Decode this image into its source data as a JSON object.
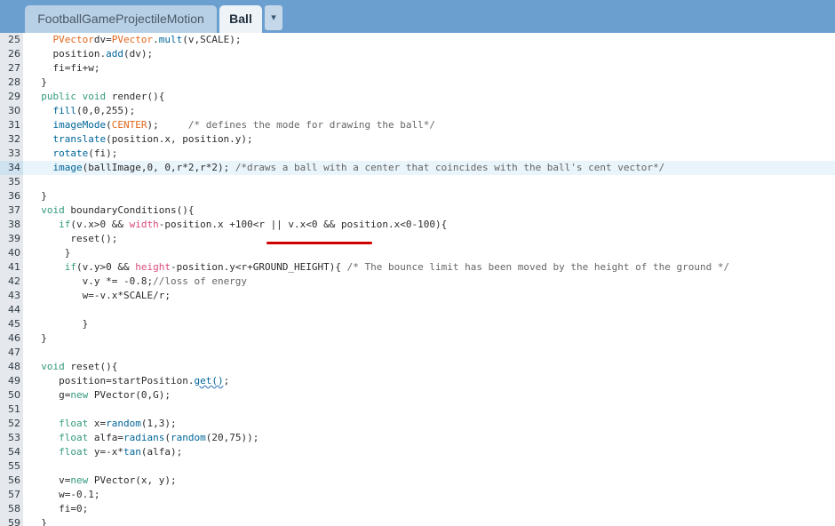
{
  "tabs": [
    {
      "label": "FootballGameProjectileMotion",
      "active": false
    },
    {
      "label": "Ball",
      "active": true
    }
  ],
  "tab_menu_icon": "▾",
  "highlighted_line": "34",
  "lines": [
    {
      "num": "25",
      "indent": "    ",
      "tokens": [
        [
          "t-type",
          "PVector"
        ],
        [
          "",
          "dv="
        ],
        [
          "t-type",
          "PVector"
        ],
        [
          "",
          "."
        ],
        [
          "t-fn",
          "mult"
        ],
        [
          "",
          "(v,SCALE);"
        ]
      ]
    },
    {
      "num": "26",
      "indent": "    ",
      "tokens": [
        [
          "",
          "position."
        ],
        [
          "t-fn",
          "add"
        ],
        [
          "",
          "(dv);"
        ]
      ]
    },
    {
      "num": "27",
      "indent": "    ",
      "tokens": [
        [
          "",
          "fi=fi+w;"
        ]
      ]
    },
    {
      "num": "28",
      "indent": "  ",
      "tokens": [
        [
          "",
          "}"
        ]
      ]
    },
    {
      "num": "29",
      "indent": "  ",
      "tokens": [
        [
          "t-kw",
          "public"
        ],
        [
          "",
          " "
        ],
        [
          "t-kw",
          "void"
        ],
        [
          "",
          " render(){"
        ]
      ]
    },
    {
      "num": "30",
      "indent": "    ",
      "tokens": [
        [
          "t-fn",
          "fill"
        ],
        [
          "",
          "(0,0,255);"
        ]
      ]
    },
    {
      "num": "31",
      "indent": "    ",
      "tokens": [
        [
          "t-fn",
          "imageMode"
        ],
        [
          "",
          "("
        ],
        [
          "t-type",
          "CENTER"
        ],
        [
          "",
          ");     "
        ],
        [
          "t-cmt",
          "/* defines the mode for drawing the ball*/"
        ]
      ]
    },
    {
      "num": "32",
      "indent": "    ",
      "tokens": [
        [
          "t-fn",
          "translate"
        ],
        [
          "",
          "(position.x, position.y);"
        ]
      ]
    },
    {
      "num": "33",
      "indent": "    ",
      "tokens": [
        [
          "t-fn",
          "rotate"
        ],
        [
          "",
          "(fi);"
        ]
      ]
    },
    {
      "num": "34",
      "indent": "    ",
      "tokens": [
        [
          "t-fn",
          "image"
        ],
        [
          "",
          "(ballImage,0, 0,r*2,r*2); "
        ],
        [
          "t-cmt",
          "/*draws a ball with a center that coincides with the ball's cent vector*/"
        ]
      ]
    },
    {
      "num": "35",
      "indent": "",
      "tokens": []
    },
    {
      "num": "36",
      "indent": "  ",
      "tokens": [
        [
          "",
          "}"
        ]
      ]
    },
    {
      "num": "37",
      "indent": "  ",
      "tokens": [
        [
          "t-kw",
          "void"
        ],
        [
          "",
          " boundaryConditions(){"
        ]
      ]
    },
    {
      "num": "38",
      "indent": "     ",
      "tokens": [
        [
          "t-kw",
          "if"
        ],
        [
          "",
          "(v.x>0 && "
        ],
        [
          "t-const",
          "width"
        ],
        [
          "",
          "-position.x +100<r || v.x<0 && position.x<0-100){"
        ]
      ]
    },
    {
      "num": "39",
      "indent": "       ",
      "tokens": [
        [
          "",
          "reset();"
        ]
      ]
    },
    {
      "num": "40",
      "indent": "      ",
      "tokens": [
        [
          "",
          "}"
        ]
      ]
    },
    {
      "num": "41",
      "indent": "      ",
      "tokens": [
        [
          "t-kw",
          "if"
        ],
        [
          "",
          "(v.y>0 && "
        ],
        [
          "t-const",
          "height"
        ],
        [
          "",
          "-position.y<r+GROUND_HEIGHT){ "
        ],
        [
          "t-cmt",
          "/* The bounce limit has been moved by the height of the ground */"
        ]
      ]
    },
    {
      "num": "42",
      "indent": "         ",
      "tokens": [
        [
          "",
          "v.y *= -0.8;"
        ],
        [
          "t-cmt",
          "//loss of energy"
        ]
      ]
    },
    {
      "num": "43",
      "indent": "         ",
      "tokens": [
        [
          "",
          "w=-v.x*SCALE/r;"
        ]
      ]
    },
    {
      "num": "44",
      "indent": "",
      "tokens": []
    },
    {
      "num": "45",
      "indent": "         ",
      "tokens": [
        [
          "",
          "}"
        ]
      ]
    },
    {
      "num": "46",
      "indent": "  ",
      "tokens": [
        [
          "",
          "}"
        ]
      ]
    },
    {
      "num": "47",
      "indent": "",
      "tokens": []
    },
    {
      "num": "48",
      "indent": "  ",
      "tokens": [
        [
          "t-kw",
          "void"
        ],
        [
          "",
          " reset(){"
        ]
      ]
    },
    {
      "num": "49",
      "indent": "     ",
      "tokens": [
        [
          "",
          "position=startPosition."
        ],
        [
          "t-fn t-squig",
          "get()"
        ],
        [
          "",
          ";"
        ]
      ]
    },
    {
      "num": "50",
      "indent": "     ",
      "tokens": [
        [
          "",
          "g="
        ],
        [
          "t-kw",
          "new"
        ],
        [
          "",
          " PVector(0,G);"
        ]
      ]
    },
    {
      "num": "51",
      "indent": "",
      "tokens": []
    },
    {
      "num": "52",
      "indent": "     ",
      "tokens": [
        [
          "t-kw",
          "float"
        ],
        [
          "",
          " x="
        ],
        [
          "t-fn",
          "random"
        ],
        [
          "",
          "(1,3);"
        ]
      ]
    },
    {
      "num": "53",
      "indent": "     ",
      "tokens": [
        [
          "t-kw",
          "float"
        ],
        [
          "",
          " alfa="
        ],
        [
          "t-fn",
          "radians"
        ],
        [
          "",
          "("
        ],
        [
          "t-fn",
          "random"
        ],
        [
          "",
          "(20,75));"
        ]
      ]
    },
    {
      "num": "54",
      "indent": "     ",
      "tokens": [
        [
          "t-kw",
          "float"
        ],
        [
          "",
          " y=-x*"
        ],
        [
          "t-fn",
          "tan"
        ],
        [
          "",
          "(alfa);"
        ]
      ]
    },
    {
      "num": "55",
      "indent": "",
      "tokens": []
    },
    {
      "num": "56",
      "indent": "     ",
      "tokens": [
        [
          "",
          "v="
        ],
        [
          "t-kw",
          "new"
        ],
        [
          "",
          " PVector(x, y);"
        ]
      ]
    },
    {
      "num": "57",
      "indent": "     ",
      "tokens": [
        [
          "",
          "w=-0.1;"
        ]
      ]
    },
    {
      "num": "58",
      "indent": "     ",
      "tokens": [
        [
          "",
          "fi=0;"
        ]
      ]
    },
    {
      "num": "59",
      "indent": "  ",
      "tokens": [
        [
          "",
          "}"
        ]
      ]
    }
  ]
}
